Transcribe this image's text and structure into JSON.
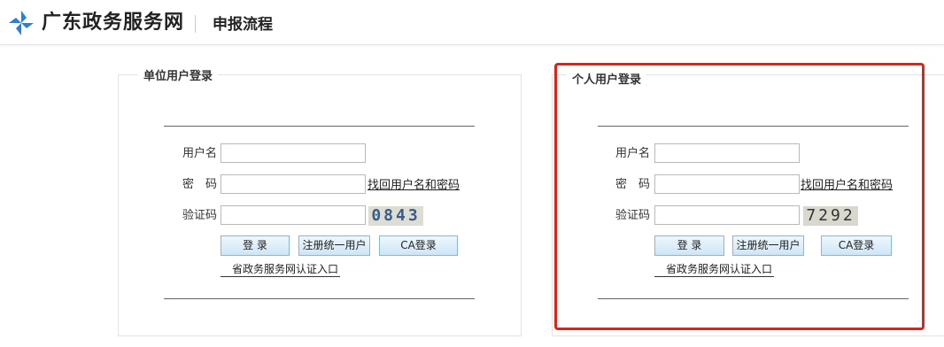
{
  "header": {
    "site_name": "广东政务服务网",
    "page_title": "申报流程",
    "logo_icon": "pinwheel-logo-icon",
    "logo_color": "#2d7fd3"
  },
  "unit_login": {
    "title": "单位用户登录",
    "username_label": "用户名",
    "password_label": "密　码",
    "captcha_label": "验证码",
    "username_value": "",
    "password_value": "",
    "captcha_value": "",
    "forgot_link": "找回用户名和密码",
    "captcha_text": "0843",
    "login_button": "登 录",
    "register_button": "注册统一用户",
    "ca_button": "CA登录",
    "portal_link": "省政务服务网认证入口"
  },
  "personal_login": {
    "title": "个人用户登录",
    "username_label": "用户名",
    "password_label": "密　码",
    "captcha_label": "验证码",
    "username_value": "",
    "password_value": "",
    "captcha_value": "",
    "forgot_link": "找回用户名和密码",
    "captcha_text": "7292",
    "login_button": "登 录",
    "register_button": "注册统一用户",
    "ca_button": "CA登录",
    "portal_link": "省政务服务网认证入口"
  },
  "colors": {
    "highlight_border": "#d9241b",
    "button_border": "#86b6da"
  }
}
